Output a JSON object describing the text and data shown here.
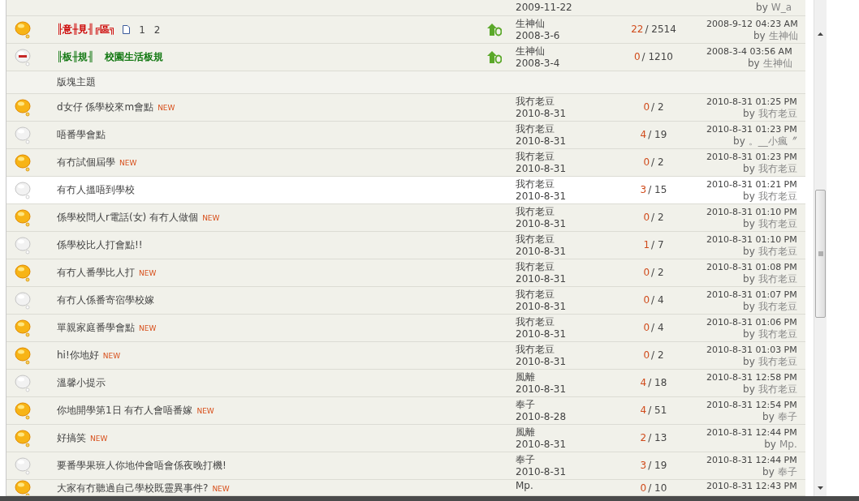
{
  "rows": [
    {
      "kind": "topic",
      "highlighted": false,
      "date": "2009-11-22",
      "last_by_label": "by",
      "last_by": "W_a"
    },
    {
      "kind": "sticky",
      "hot": true,
      "closed": false,
      "color": "#cc0000",
      "parts": [
        "╟意╫見╢╔區╗"
      ],
      "pages": [
        "1",
        "2"
      ],
      "author": "生神仙",
      "date": "2008-3-6",
      "replies": "22",
      "views": "/ 2514",
      "last_time": "2008-9-12 04:23 AM",
      "last_by_label": "by",
      "last_by": "生神仙"
    },
    {
      "kind": "sticky",
      "hot": false,
      "closed": true,
      "color": "#117711",
      "parts": [
        "╟板╫規╢",
        "校園生活板規"
      ],
      "author": "生神仙",
      "date": "2008-3-4",
      "replies": "0",
      "views": "/ 1210",
      "last_time": "2008-3-4 03:56 AM",
      "last_by_label": "by",
      "last_by": "生神仙"
    },
    {
      "kind": "header",
      "title": "版塊主題"
    },
    {
      "kind": "topic",
      "hot": true,
      "closed": false,
      "highlighted": false,
      "title": "d女仔 係學校來m會點",
      "badge": "NEW",
      "author": "我冇老豆",
      "date": "2010-8-31",
      "replies": "0",
      "views": "/ 2",
      "last_time": "2010-8-31 01:25 PM",
      "last_by_label": "by",
      "last_by": "我冇老豆"
    },
    {
      "kind": "topic",
      "hot": false,
      "closed": false,
      "highlighted": false,
      "title": "唔番學會點",
      "author": "我冇老豆",
      "date": "2010-8-31",
      "replies": "4",
      "views": "/ 19",
      "last_time": "2010-8-31 01:23 PM",
      "last_by_label": "by",
      "last_by": "。__小瘋〞"
    },
    {
      "kind": "topic",
      "hot": true,
      "closed": false,
      "highlighted": false,
      "title": "有冇試個屆學",
      "badge": "NEW",
      "author": "我冇老豆",
      "date": "2010-8-31",
      "replies": "0",
      "views": "/ 2",
      "last_time": "2010-8-31 01:23 PM",
      "last_by_label": "by",
      "last_by": "我冇老豆"
    },
    {
      "kind": "topic",
      "hot": false,
      "closed": false,
      "highlighted": true,
      "title": "有冇人搵唔到學校",
      "author": "我冇老豆",
      "date": "2010-8-31",
      "replies": "3",
      "views": "/ 15",
      "last_time": "2010-8-31 01:21 PM",
      "last_by_label": "by",
      "last_by": "我冇老豆"
    },
    {
      "kind": "topic",
      "hot": true,
      "closed": false,
      "highlighted": false,
      "title": "係學校問人r電話(女) 有冇人做個",
      "badge": "NEW",
      "author": "我冇老豆",
      "date": "2010-8-31",
      "replies": "0",
      "views": "/ 2",
      "last_time": "2010-8-31 01:10 PM",
      "last_by_label": "by",
      "last_by": "我冇老豆"
    },
    {
      "kind": "topic",
      "hot": false,
      "closed": false,
      "highlighted": false,
      "title": "係學校比人打會點!!",
      "author": "我冇老豆",
      "date": "2010-8-31",
      "replies": "1",
      "views": "/ 7",
      "last_time": "2010-8-31 01:10 PM",
      "last_by_label": "by",
      "last_by": "我冇老豆"
    },
    {
      "kind": "topic",
      "hot": true,
      "closed": false,
      "highlighted": false,
      "title": "有冇人番學比人打",
      "badge": "NEW",
      "author": "我冇老豆",
      "date": "2010-8-31",
      "replies": "0",
      "views": "/ 2",
      "last_time": "2010-8-31 01:08 PM",
      "last_by_label": "by",
      "last_by": "我冇老豆"
    },
    {
      "kind": "topic",
      "hot": false,
      "closed": false,
      "highlighted": false,
      "title": "有冇人係番寄宿學校嫁",
      "author": "我冇老豆",
      "date": "2010-8-31",
      "replies": "0",
      "views": "/ 4",
      "last_time": "2010-8-31 01:07 PM",
      "last_by_label": "by",
      "last_by": "我冇老豆"
    },
    {
      "kind": "topic",
      "hot": true,
      "closed": false,
      "highlighted": false,
      "title": "單親家庭番學會點",
      "badge": "NEW",
      "author": "我冇老豆",
      "date": "2010-8-31",
      "replies": "0",
      "views": "/ 4",
      "last_time": "2010-8-31 01:06 PM",
      "last_by_label": "by",
      "last_by": "我冇老豆"
    },
    {
      "kind": "topic",
      "hot": true,
      "closed": false,
      "highlighted": false,
      "title": "hi!你地好",
      "badge": "NEW",
      "author": "我冇老豆",
      "date": "2010-8-31",
      "replies": "0",
      "views": "/ 2",
      "last_time": "2010-8-31 01:03 PM",
      "last_by_label": "by",
      "last_by": "我冇老豆"
    },
    {
      "kind": "topic",
      "hot": false,
      "closed": false,
      "highlighted": false,
      "title": "溫馨小提示",
      "author": "風離",
      "date": "2010-8-31",
      "replies": "4",
      "views": "/ 18",
      "last_time": "2010-8-31 12:58 PM",
      "last_by_label": "by",
      "last_by": "我冇老豆"
    },
    {
      "kind": "topic",
      "hot": true,
      "closed": false,
      "highlighted": false,
      "title": "你地開學第1日 有冇人會唔番嫁",
      "badge": "NEW",
      "author": "奉子",
      "date": "2010-8-28",
      "replies": "4",
      "views": "/ 51",
      "last_time": "2010-8-31 12:54 PM",
      "last_by_label": "by",
      "last_by": "奉子"
    },
    {
      "kind": "topic",
      "hot": true,
      "closed": false,
      "highlighted": false,
      "title": "好搞笑",
      "badge": "NEW",
      "author": "風離",
      "date": "2010-8-31",
      "replies": "2",
      "views": "/ 13",
      "last_time": "2010-8-31 12:44 PM",
      "last_by_label": "by",
      "last_by": "Mp."
    },
    {
      "kind": "topic",
      "hot": false,
      "closed": false,
      "highlighted": false,
      "title": "要番學果班人你地仲會唔會係夜晚打機!",
      "author": "奉子",
      "date": "2010-8-31",
      "replies": "3",
      "views": "/ 19",
      "last_time": "2010-8-31 12:44 PM",
      "last_by_label": "by",
      "last_by": "奉子"
    },
    {
      "kind": "topic",
      "hot": true,
      "closed": false,
      "highlighted": false,
      "title": "大家有冇聽過自己學校既靈異事件?",
      "badge": "NEW",
      "author": "Mp.",
      "replies": "0",
      "views": "/ 10",
      "last_time": "2010-8-31 12:43 PM"
    }
  ]
}
